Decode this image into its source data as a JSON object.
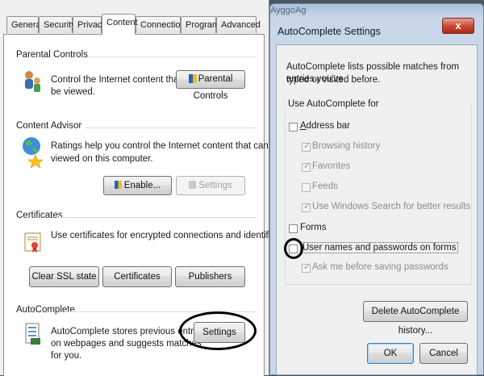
{
  "tabs": [
    "General",
    "Security",
    "Privacy",
    "Content",
    "Connections",
    "Programs",
    "Advanced"
  ],
  "active_tab": "Content",
  "parental": {
    "title": "Parental Controls",
    "desc_line1": "Control the Internet content that can",
    "desc_line2": "be viewed.",
    "button": "Parental Controls"
  },
  "advisor": {
    "title": "Content Advisor",
    "desc_line1": "Ratings help you control the Internet content that can be",
    "desc_line2": "viewed on this computer.",
    "enable_button": "Enable...",
    "settings_button": "Settings"
  },
  "certificates": {
    "title": "Certificates",
    "desc": "Use certificates for encrypted connections and identification.",
    "clear_ssl_button": "Clear SSL state",
    "certificates_button": "Certificates",
    "publishers_button": "Publishers"
  },
  "autocomplete": {
    "title": "AutoComplete",
    "desc_line1": "AutoComplete stores previous entries",
    "desc_line2": "on webpages and suggests matches",
    "desc_line3": "for you.",
    "settings_button": "Settings"
  },
  "dialog": {
    "background_text": "AyggoAg",
    "title": "AutoComplete Settings",
    "close": "x",
    "intro_line1": "AutoComplete lists possible matches from entries you've",
    "intro_line2": "typed or visited before.",
    "group_title": "Use AutoComplete for",
    "address_bar": "Address bar",
    "browsing_history": "Browsing history",
    "favorites": "Favorites",
    "feeds": "Feeds",
    "windows_search": "Use Windows Search for better results",
    "forms": "Forms",
    "user_names": "User names and passwords on forms",
    "ask_before": "Ask me before saving passwords",
    "delete_button": "Delete AutoComplete history...",
    "ok_button": "OK",
    "cancel_button": "Cancel"
  }
}
